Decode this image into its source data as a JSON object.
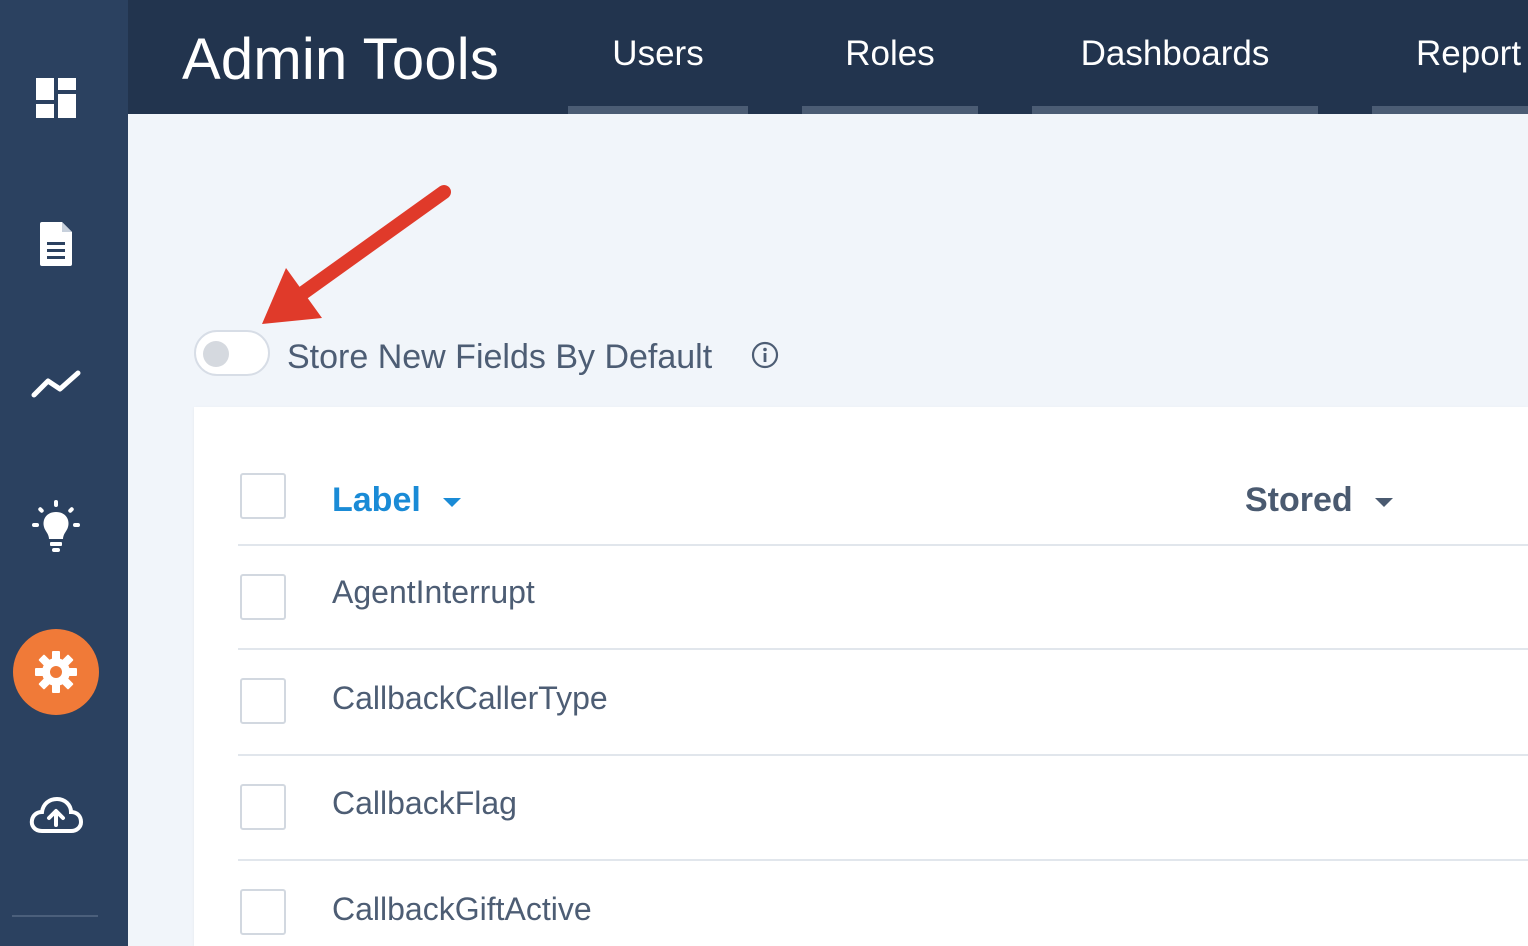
{
  "app": {
    "title": "Admin Tools"
  },
  "sidebar": {
    "items": [
      {
        "icon": "dashboard-icon"
      },
      {
        "icon": "document-icon"
      },
      {
        "icon": "trend-line-icon"
      },
      {
        "icon": "lightbulb-icon"
      },
      {
        "icon": "gear-icon",
        "active": true
      },
      {
        "icon": "cloud-upload-icon"
      }
    ],
    "active_color": "#f07a38"
  },
  "nav": {
    "tabs": [
      {
        "label": "Users"
      },
      {
        "label": "Roles"
      },
      {
        "label": "Dashboards"
      },
      {
        "label": "Report"
      }
    ]
  },
  "settings": {
    "store_new_fields_label": "Store New Fields By Default",
    "store_new_fields_enabled": false
  },
  "table": {
    "columns": {
      "label": "Label",
      "stored": "Stored"
    },
    "rows": [
      {
        "label": "AgentInterrupt"
      },
      {
        "label": "CallbackCallerType"
      },
      {
        "label": "CallbackFlag"
      },
      {
        "label": "CallbackGiftActive"
      }
    ]
  },
  "colors": {
    "sidebar_bg": "#2b4160",
    "header_bg": "#22344e",
    "link_blue": "#1a8bd6",
    "annotation_arrow": "#e03a2a"
  }
}
